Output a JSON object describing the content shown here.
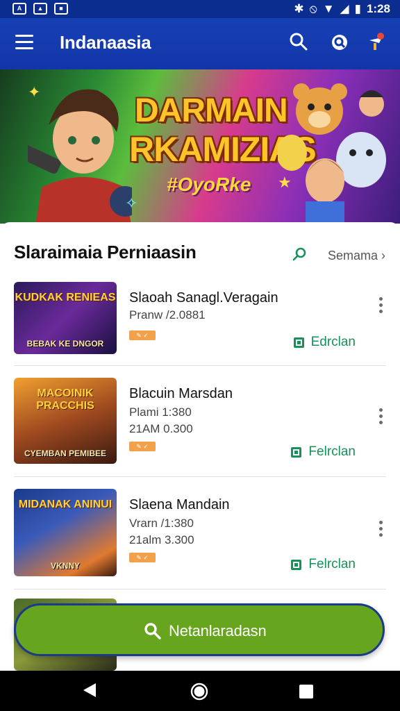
{
  "status_bar": {
    "time": "1:28"
  },
  "app_bar": {
    "title": "Indanaasia",
    "icons": [
      "menu-icon",
      "search-icon",
      "settings-icon",
      "notification-icon"
    ]
  },
  "banner": {
    "line1": "DARMAIN",
    "line2": "RKAMIZIAS",
    "line3": "#OyoRke"
  },
  "section": {
    "title": "Slaraimaia Perniaasin",
    "see_all": "Semama"
  },
  "items": [
    {
      "thumb_title": "KUDKAK RENIEAS",
      "thumb_sub": "BEBAK KE DNGOR",
      "name": "Slaoah Sanagl.Veragain",
      "meta1": "Pranw /2.0881",
      "meta2": "",
      "action": "Edrclan"
    },
    {
      "thumb_title": "MACOINIK PRACCHIS",
      "thumb_sub": "CYEMBAN PEMIBEE",
      "name": "Blacuin Marsdan",
      "meta1": "Plami 1:380",
      "meta2": "21AM 0.300",
      "action": "Felrclan"
    },
    {
      "thumb_title": "MIDANAK ANINUI",
      "thumb_sub": "VKNNY",
      "name": "Slaena Mandain",
      "meta1": "Vrarn /1:380",
      "meta2": "21alm 3.300",
      "action": "Felrclan"
    }
  ],
  "fab": {
    "label": "Netanlaradasn"
  },
  "colors": {
    "primary": "#1236a8",
    "accent_green": "#66a51d",
    "action_green": "#17915a"
  }
}
